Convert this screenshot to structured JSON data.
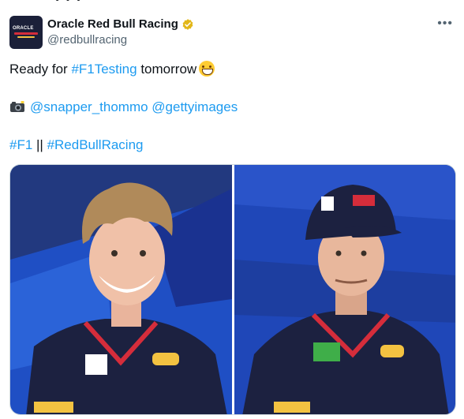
{
  "account": {
    "display_name": "Oracle Red Bull Racing",
    "handle": "@redbullracing",
    "verified": true,
    "verified_color": "#e2b719",
    "avatar_icon": "red-bull-racing-logo-icon",
    "avatar_text": "ORACLE"
  },
  "actions": {
    "more_icon": "more-horizontal-icon"
  },
  "tweet": {
    "line1_prefix": "Ready for ",
    "line1_hashtag": "#F1Testing",
    "line1_suffix": " tomorrow",
    "line1_emoji": "grinning-face-emoji",
    "line2_camera_emoji": "camera-with-flash-emoji",
    "line2_mention1": "@snapper_thommo",
    "line2_mention2": "@gettyimages",
    "line3_hashtag1": "#F1",
    "line3_separator": " || ",
    "line3_hashtag2": "#RedBullRacing",
    "link_color": "#1d9bf0"
  },
  "media": {
    "images": [
      {
        "name": "driver-portrait-left",
        "description_icon": "photo-icon"
      },
      {
        "name": "driver-portrait-right",
        "description_icon": "photo-icon"
      }
    ]
  }
}
